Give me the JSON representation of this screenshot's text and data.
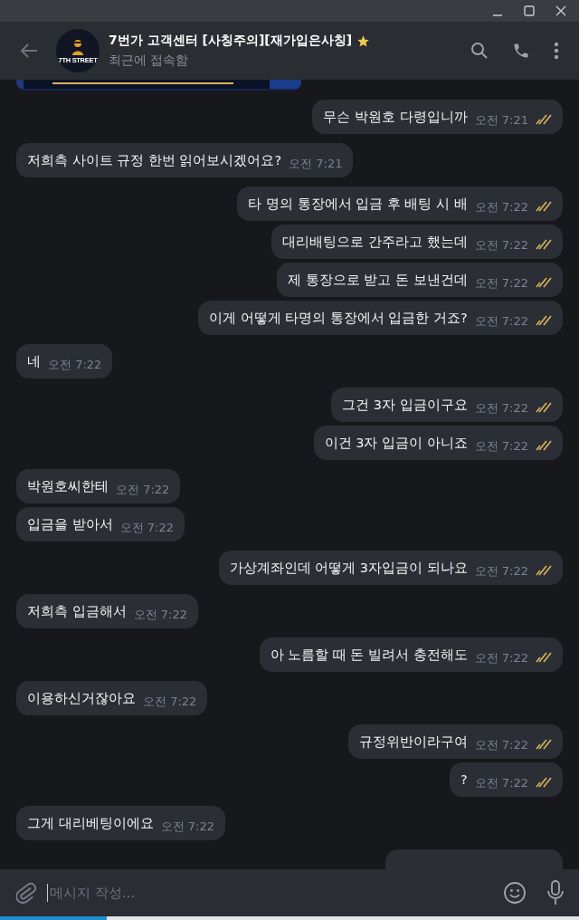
{
  "header": {
    "title": "7번가 고객센터 [사칭주의][재가입은사칭]",
    "starred": true,
    "status": "최근에 접속함",
    "avatar_text": "7TH STREET"
  },
  "messages": [
    {
      "kind": "picture"
    },
    {
      "kind": "outgoing",
      "text": "무슨 박원호 다령입니까",
      "time": "오전 7:21",
      "read": true
    },
    {
      "kind": "incoming",
      "text": "저희측 사이트 규정 한번 읽어보시겠어요?",
      "time": "오전 7:21"
    },
    {
      "kind": "outgoing",
      "text": "타 명의 통장에서 입금 후 배팅 시 배",
      "time": "오전 7:22",
      "read": true
    },
    {
      "kind": "outgoing",
      "text": "대리배팅으로 간주라고 했는데",
      "time": "오전 7:22",
      "read": true
    },
    {
      "kind": "outgoing",
      "text": "제 통장으로 받고 돈 보낸건데",
      "time": "오전 7:22",
      "read": true
    },
    {
      "kind": "outgoing",
      "text": "이게 어떻게 타명의 통장에서 입금한 거죠?",
      "time": "오전 7:22",
      "read": true
    },
    {
      "kind": "incoming",
      "text": "네",
      "time": "오전 7:22"
    },
    {
      "kind": "outgoing",
      "text": "그건 3자 입금이구요",
      "time": "오전 7:22",
      "read": true
    },
    {
      "kind": "outgoing",
      "text": "이건 3자 입금이 아니죠",
      "time": "오전 7:22",
      "read": true
    },
    {
      "kind": "incoming",
      "text": "박원호씨한테",
      "time": "오전 7:22"
    },
    {
      "kind": "incoming",
      "text": "입금을 받아서",
      "time": "오전 7:22"
    },
    {
      "kind": "outgoing",
      "text": "가상계좌인데 어떻게 3자입금이 되나요",
      "time": "오전 7:22",
      "read": true
    },
    {
      "kind": "incoming",
      "text": "저희측 입금해서",
      "time": "오전 7:22"
    },
    {
      "kind": "outgoing",
      "text": "아 노름할 때 돈 빌려서 충전해도",
      "time": "오전 7:22",
      "read": true
    },
    {
      "kind": "incoming",
      "text": "이용하신거잖아요",
      "time": "오전 7:22"
    },
    {
      "kind": "outgoing",
      "text": "규정위반이라구여",
      "time": "오전 7:22",
      "read": true
    },
    {
      "kind": "outgoing",
      "text": "?",
      "time": "오전 7:22",
      "read": true
    },
    {
      "kind": "incoming",
      "text": "그게 대리베팅이에요",
      "time": "오전 7:22"
    },
    {
      "kind": "clipped_outgoing"
    }
  ],
  "composer": {
    "placeholder": "메시지 작성..."
  },
  "loading": {
    "level": 0.185
  }
}
